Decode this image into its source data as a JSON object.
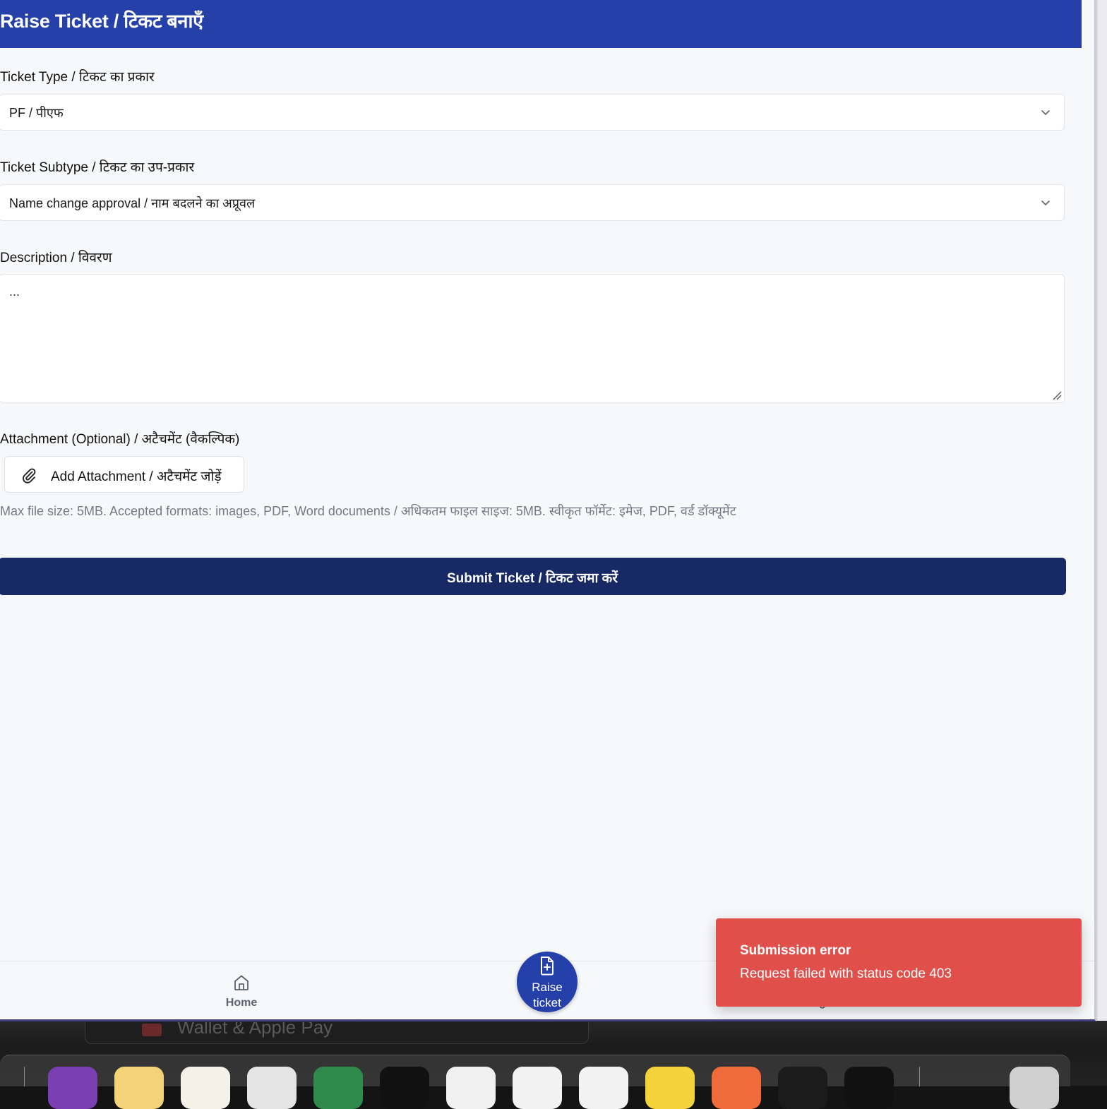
{
  "header": {
    "title": "Raise Ticket / टिकट बनाएँ"
  },
  "form": {
    "ticket_type": {
      "label": "Ticket Type / टिकट का प्रकार",
      "value": "PF / पीएफ"
    },
    "ticket_subtype": {
      "label": "Ticket Subtype / टिकट का उप-प्रकार",
      "value": "Name change approval / नाम बदलने का अप्रूवल"
    },
    "description": {
      "label": "Description / विवरण",
      "value": "..."
    },
    "attachment": {
      "label": "Attachment (Optional) / अटैचमेंट (वैकल्पिक)",
      "button_label": "Add Attachment / अटैचमेंट जोड़ें",
      "hint": "Max file size: 5MB. Accepted formats: images, PDF, Word documents / अधिकतम फाइल साइज: 5MB. स्वीकृत फॉर्मेट: इमेज, PDF, वर्ड डॉक्यूमेंट"
    },
    "submit_label": "Submit Ticket / टिकट जमा करें"
  },
  "bottom_nav": {
    "home_label": "Home",
    "raise_label_line1": "Raise",
    "raise_label_line2": "ticket"
  },
  "toast": {
    "title": "Submission error",
    "message": "Request failed with status code 403",
    "color": "#e04f4a"
  },
  "background": {
    "window_text": "Wallet & Apple Pay"
  },
  "colors": {
    "header": "#2540a8",
    "submit": "#182a66",
    "fab": "#2540a8"
  },
  "dock": {
    "apps": [
      {
        "icon": "generic-app-icon",
        "color": "#7a3fb0"
      },
      {
        "icon": "generic-app-icon",
        "color": "#f3d27a"
      },
      {
        "icon": "generic-app-icon",
        "color": "#f4f1e8"
      },
      {
        "icon": "chrome-icon",
        "color": "#e4e4e4"
      },
      {
        "icon": "spreadsheet-icon",
        "color": "#2f8a4c"
      },
      {
        "icon": "terminal-icon",
        "color": "#111111"
      },
      {
        "icon": "code-editor-icon",
        "color": "#f0f0f0"
      },
      {
        "icon": "presentation-icon",
        "color": "#f2f2f2"
      },
      {
        "icon": "document-icon",
        "color": "#f2f2f2"
      },
      {
        "icon": "generic-app-icon",
        "color": "#f4d23c"
      },
      {
        "icon": "generic-app-icon",
        "color": "#ef6b3a"
      },
      {
        "icon": "activity-monitor-icon",
        "color": "#1b1b1b"
      },
      {
        "icon": "generic-app-icon",
        "color": "#111111"
      },
      {
        "icon": "trash-icon",
        "color": "#cfcfcf"
      }
    ]
  }
}
